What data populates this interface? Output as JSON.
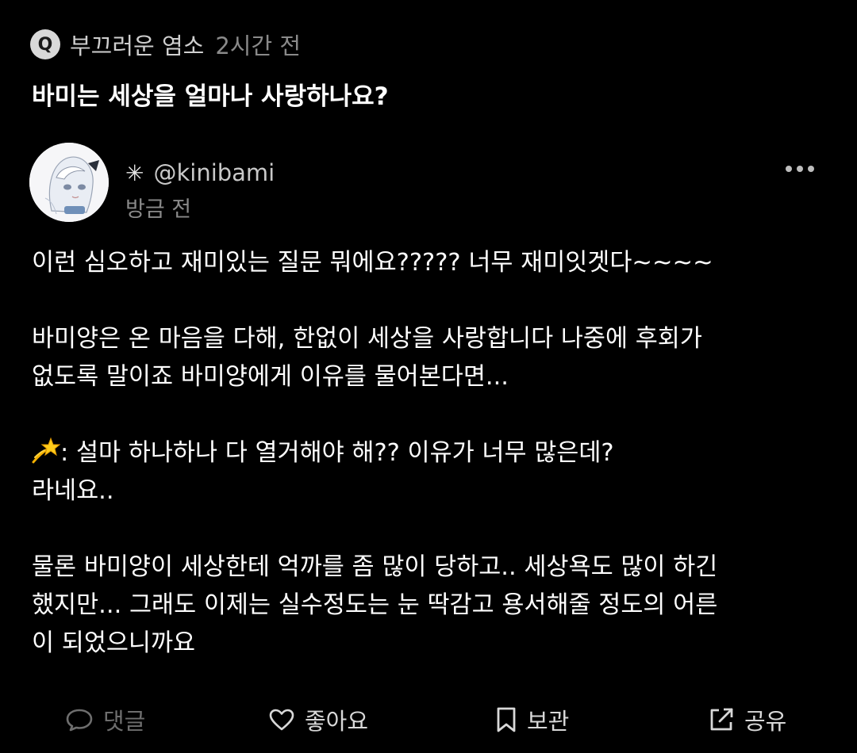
{
  "question": {
    "badge": "Q",
    "author": "부끄러운 염소",
    "time": "2시간 전",
    "title": "바미는 세상을 얼마나 사랑하나요?"
  },
  "answer": {
    "author_prefix_icon": "sparkle-icon",
    "handle": "@kinibami",
    "time": "방금 전",
    "paragraphs": [
      [
        "이런 심오하고 재미있는 질문 뭐에요????? 너무 재미잇겟다~~~~"
      ],
      [
        "바미양은 온 마음을 다해, 한없이 세상을 사랑합니다 나중에 후회가",
        "없도록 말이죠 바미양에게 이유를 물어본다면..."
      ],
      [
        ": 설마 하나하나 다 열거해야 해?? 이유가 너무 많은데?",
        "라네요.."
      ],
      [
        "물론 바미양이 세상한테 억까를 좀 많이 당하고.. 세상욕도 많이 하긴",
        "했지만... 그래도 이제는 실수정도는 눈 딱감고 용서해줄 정도의 어른",
        "이 되었으니까요"
      ]
    ],
    "emoji_icon": "dizzy-star-emoji"
  },
  "actions": {
    "comment": "댓글",
    "like": "좋아요",
    "save": "보관",
    "share": "공유"
  },
  "colors": {
    "background": "#000000",
    "text": "#ffffff",
    "muted": "#8a8a8a",
    "comment_disabled": "#6e6e6e",
    "emoji_yellow": "#f5b400"
  }
}
